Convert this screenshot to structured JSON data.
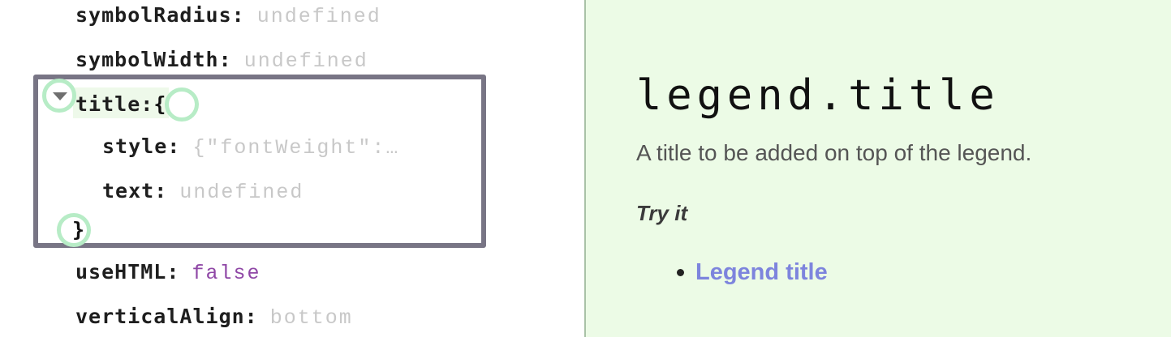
{
  "tree": {
    "rows": [
      {
        "key": "symbolRadius:",
        "value": "undefined"
      },
      {
        "key": "symbolWidth:",
        "value": "undefined"
      },
      {
        "key": "title:",
        "value": "{"
      },
      {
        "key": "style:",
        "value": "{\"fontWeight\":…"
      },
      {
        "key": "text:",
        "value": "undefined"
      },
      {
        "key": "",
        "value": "}"
      },
      {
        "key": "useHTML:",
        "value": "false"
      },
      {
        "key": "verticalAlign:",
        "value": "bottom"
      }
    ]
  },
  "doc": {
    "title": "legend.title",
    "description": "A title to be added on top of the legend.",
    "try_it_label": "Try it",
    "links": [
      "Legend title"
    ]
  },
  "colors": {
    "doc_background": "#ecfbe6",
    "highlight_border": "#787585",
    "ring": "#b7ecc6",
    "link": "#7d84dd",
    "boolean_value": "#8f47a6",
    "muted_value": "#c8c8c8"
  }
}
